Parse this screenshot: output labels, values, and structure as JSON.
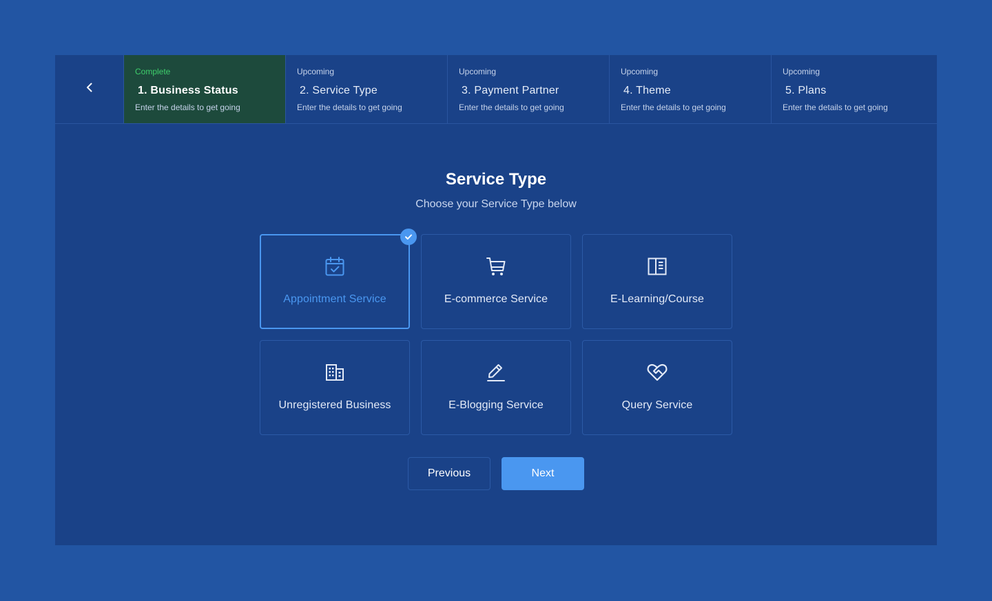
{
  "stepper": {
    "back_icon": "chevron-left-icon",
    "steps": [
      {
        "status": "Complete",
        "title": "1. Business Status",
        "description": "Enter the details to get going",
        "state": "complete"
      },
      {
        "status": "Upcoming",
        "title": "2. Service Type",
        "description": "Enter the details to get going",
        "state": "upcoming"
      },
      {
        "status": "Upcoming",
        "title": "3. Payment Partner",
        "description": "Enter the details to get going",
        "state": "upcoming"
      },
      {
        "status": "Upcoming",
        "title": "4. Theme",
        "description": "Enter the details to get going",
        "state": "upcoming"
      },
      {
        "status": "Upcoming",
        "title": "5. Plans",
        "description": "Enter the details to get going",
        "state": "upcoming"
      }
    ]
  },
  "main": {
    "title": "Service Type",
    "subtitle": "Choose your Service Type below"
  },
  "services": [
    {
      "label": "Appointment Service",
      "icon": "calendar-check-icon",
      "selected": true
    },
    {
      "label": "E-commerce Service",
      "icon": "shopping-cart-icon",
      "selected": false
    },
    {
      "label": "E-Learning/Course",
      "icon": "book-open-icon",
      "selected": false
    },
    {
      "label": "Unregistered Business",
      "icon": "building-icon",
      "selected": false
    },
    {
      "label": "E-Blogging Service",
      "icon": "pen-icon",
      "selected": false
    },
    {
      "label": "Query Service",
      "icon": "heart-handshake-icon",
      "selected": false
    }
  ],
  "actions": {
    "previous_label": "Previous",
    "next_label": "Next"
  },
  "colors": {
    "page_background": "#2255a3",
    "panel_background": "#1a4288",
    "complete_step_background": "#1d4a3c",
    "complete_status": "#3ecf6b",
    "accent": "#4a97f0"
  }
}
